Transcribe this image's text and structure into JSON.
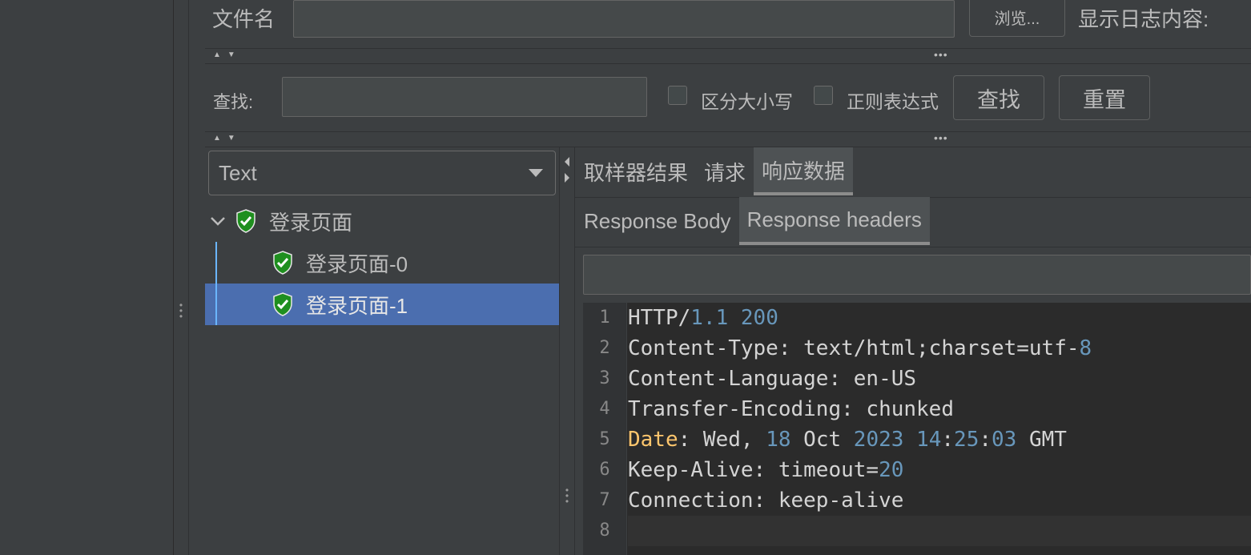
{
  "file": {
    "label": "文件名",
    "value": "",
    "browse_label": "浏览...",
    "show_log_label": "显示日志内容:"
  },
  "search": {
    "label": "查找:",
    "value": "",
    "case_label": "区分大小写",
    "regex_label": "正则表达式",
    "find_label": "查找",
    "reset_label": "重置"
  },
  "renderer": {
    "selected": "Text"
  },
  "tree": {
    "root": "登录页面",
    "children": [
      "登录页面-0",
      "登录页面-1"
    ],
    "selected_index": 1
  },
  "tabs": {
    "main": [
      "取样器结果",
      "请求",
      "响应数据"
    ],
    "main_active": 2,
    "sub": [
      "Response Body",
      "Response headers"
    ],
    "sub_active": 1
  },
  "editor": {
    "filter_value": "",
    "line_numbers": [
      "1",
      "2",
      "3",
      "4",
      "5",
      "6",
      "7",
      "8"
    ],
    "lines": [
      "HTTP/1.1 200",
      "Content-Type: text/html;charset=utf-8",
      "Content-Language: en-US",
      "Transfer-Encoding: chunked",
      "Date: Wed, 18 Oct 2023 14:25:03 GMT",
      "Keep-Alive: timeout=20",
      "Connection: keep-alive",
      ""
    ]
  },
  "colors": {
    "background": "#3c3f41",
    "editor_bg": "#2b2b2b",
    "selection": "#4b6eaf",
    "number": "#6897bb",
    "key_highlight": "#ffc66d",
    "success_green": "#2eaa2e"
  },
  "icons": {
    "tree_expand": "chevron-down-icon",
    "status": "shield-check-icon",
    "split_arrows": "up-down-arrows-icon"
  }
}
